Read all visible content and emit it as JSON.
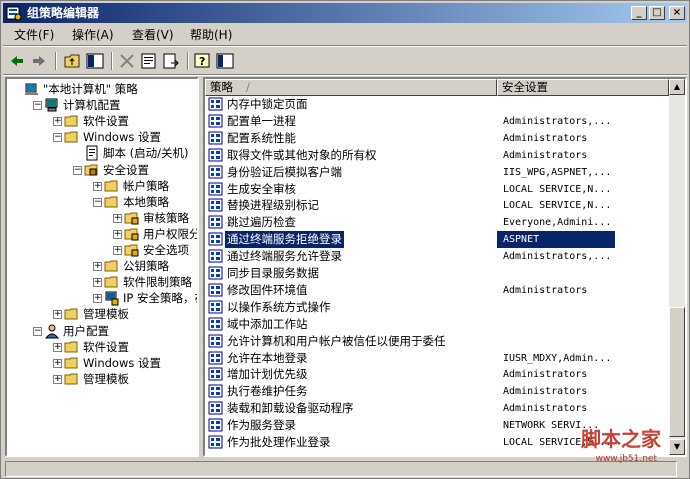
{
  "window": {
    "title": "组策略编辑器",
    "min_label": "_",
    "max_label": "□",
    "close_label": "×"
  },
  "menu": [
    {
      "label": "文件(F)"
    },
    {
      "label": "操作(A)"
    },
    {
      "label": "查看(V)"
    },
    {
      "label": "帮助(H)"
    }
  ],
  "toolbar": {
    "icons": [
      "back-icon",
      "forward-icon",
      "up-folder-icon",
      "show-hide-tree-icon",
      "delete-icon",
      "properties-icon",
      "export-list-icon",
      "help-icon",
      "help-topics-icon"
    ]
  },
  "tree": {
    "items": [
      {
        "label": "\"本地计算机\" 策略",
        "level": 0,
        "expander": "",
        "icon": "policy-computer-icon"
      },
      {
        "label": "计算机配置",
        "level": 1,
        "expander": "−",
        "icon": "computer-icon"
      },
      {
        "label": "软件设置",
        "level": 2,
        "expander": "+",
        "icon": "folder-icon"
      },
      {
        "label": "Windows 设置",
        "level": 2,
        "expander": "−",
        "icon": "folder-icon"
      },
      {
        "label": "脚本 (启动/关机)",
        "level": 3,
        "expander": "",
        "icon": "script-icon"
      },
      {
        "label": "安全设置",
        "level": 3,
        "expander": "−",
        "icon": "security-icon"
      },
      {
        "label": "帐户策略",
        "level": 4,
        "expander": "+",
        "icon": "folder-icon"
      },
      {
        "label": "本地策略",
        "level": 4,
        "expander": "−",
        "icon": "folder-icon"
      },
      {
        "label": "审核策略",
        "level": 5,
        "expander": "+",
        "icon": "folder-lock-icon"
      },
      {
        "label": "用户权限分配",
        "level": 5,
        "expander": "+",
        "icon": "folder-lock-icon"
      },
      {
        "label": "安全选项",
        "level": 5,
        "expander": "+",
        "icon": "folder-lock-icon"
      },
      {
        "label": "公钥策略",
        "level": 4,
        "expander": "+",
        "icon": "folder-icon"
      },
      {
        "label": "软件限制策略",
        "level": 4,
        "expander": "+",
        "icon": "folder-icon"
      },
      {
        "label": "IP 安全策略，在",
        "level": 4,
        "expander": "+",
        "icon": "ipsec-icon"
      },
      {
        "label": "管理模板",
        "level": 2,
        "expander": "+",
        "icon": "folder-icon"
      },
      {
        "label": "用户配置",
        "level": 1,
        "expander": "−",
        "icon": "user-icon"
      },
      {
        "label": "软件设置",
        "level": 2,
        "expander": "+",
        "icon": "folder-icon"
      },
      {
        "label": "Windows 设置",
        "level": 2,
        "expander": "+",
        "icon": "folder-icon"
      },
      {
        "label": "管理模板",
        "level": 2,
        "expander": "+",
        "icon": "folder-icon"
      }
    ]
  },
  "list": {
    "columns": [
      "策略",
      "安全设置"
    ],
    "sort_indicator": "/",
    "rows": [
      {
        "policy": "内存中锁定页面",
        "setting": ""
      },
      {
        "policy": "配置单一进程",
        "setting": "Administrators,..."
      },
      {
        "policy": "配置系统性能",
        "setting": "Administrators"
      },
      {
        "policy": "取得文件或其他对象的所有权",
        "setting": "Administrators"
      },
      {
        "policy": "身份验证后模拟客户端",
        "setting": "IIS_WPG,ASPNET,..."
      },
      {
        "policy": "生成安全审核",
        "setting": "LOCAL SERVICE,N..."
      },
      {
        "policy": "替换进程级别标记",
        "setting": "LOCAL SERVICE,N..."
      },
      {
        "policy": "跳过遍历检查",
        "setting": "Everyone,Admini..."
      },
      {
        "policy": "通过终端服务拒绝登录",
        "setting": "ASPNET",
        "selected": true
      },
      {
        "policy": "通过终端服务允许登录",
        "setting": "Administrators,..."
      },
      {
        "policy": "同步目录服务数据",
        "setting": ""
      },
      {
        "policy": "修改固件环境值",
        "setting": "Administrators"
      },
      {
        "policy": "以操作系统方式操作",
        "setting": ""
      },
      {
        "policy": "域中添加工作站",
        "setting": ""
      },
      {
        "policy": "允许计算机和用户帐户被信任以便用于委任",
        "setting": ""
      },
      {
        "policy": "允许在本地登录",
        "setting": "IUSR_MDXY,Admin..."
      },
      {
        "policy": "增加计划优先级",
        "setting": "Administrators"
      },
      {
        "policy": "执行卷维护任务",
        "setting": "Administrators"
      },
      {
        "policy": "装载和卸载设备驱动程序",
        "setting": "Administrators"
      },
      {
        "policy": "作为服务登录",
        "setting": "NETWORK SERVI..."
      },
      {
        "policy": "作为批处理作业登录",
        "setting": "LOCAL SERVICE,S..."
      }
    ]
  },
  "watermark": {
    "text": "脚本之家",
    "url": "www.jb51.net"
  },
  "colors": {
    "selection": "#0a246a",
    "titlebar_start": "#0a246a",
    "titlebar_end": "#a6caf0"
  }
}
